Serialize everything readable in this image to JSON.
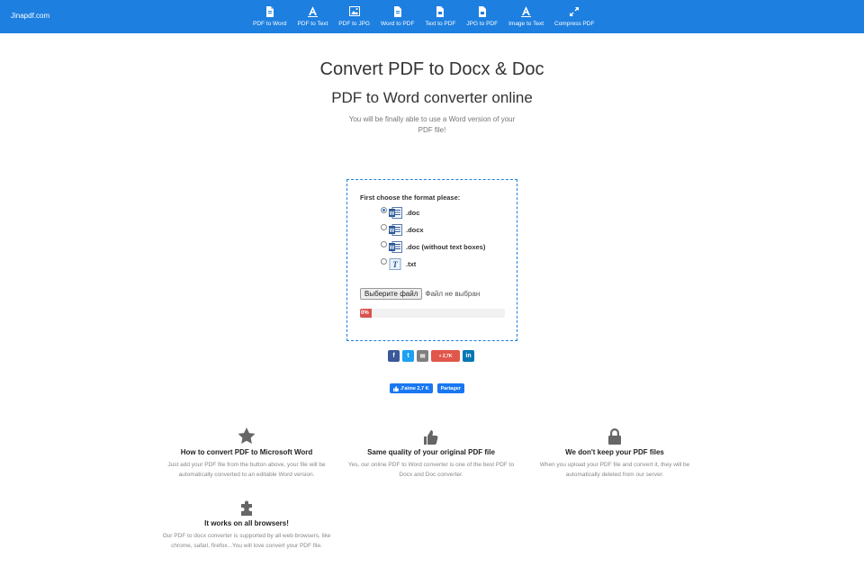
{
  "brand": "Jinapdf.com",
  "nav": [
    {
      "label": "PDF to Word",
      "icon": "file-word-icon"
    },
    {
      "label": "PDF to Text",
      "icon": "text-a-icon"
    },
    {
      "label": "PDF to JPG",
      "icon": "image-icon"
    },
    {
      "label": "Word to PDF",
      "icon": "file-word-icon"
    },
    {
      "label": "Text to PDF",
      "icon": "file-pdf-icon"
    },
    {
      "label": "JPG to PDF",
      "icon": "file-pdf-icon"
    },
    {
      "label": "Image to Text",
      "icon": "text-a-icon"
    },
    {
      "label": "Compress PDF",
      "icon": "compress-icon"
    }
  ],
  "hero": {
    "title": "Convert PDF to Docx & Doc",
    "subtitle": "PDF to Word converter online",
    "lead": "You will be finally able to use a Word version of your PDF file!"
  },
  "converter": {
    "format_label": "First choose the format please:",
    "options": [
      {
        "label": ".doc",
        "icon": "word-doc-icon",
        "checked": true
      },
      {
        "label": ".docx",
        "icon": "word-doc-icon",
        "checked": false
      },
      {
        "label": ".doc (without text boxes)",
        "icon": "word-doc-icon",
        "checked": false
      },
      {
        "label": ".txt",
        "icon": "text-file-icon",
        "checked": false
      }
    ],
    "file_button": "Выберите файл",
    "file_status": "Файл не выбран",
    "progress_label": "0%",
    "progress_value": 0,
    "progress_color": "#d9534f"
  },
  "share": {
    "buttons": [
      {
        "name": "facebook",
        "glyph": "f",
        "color": "#3b5998"
      },
      {
        "name": "twitter",
        "glyph": "t",
        "color": "#1da1f2"
      },
      {
        "name": "email",
        "glyph": "✉",
        "color": "#7f7f7f"
      },
      {
        "name": "google-plus",
        "glyph": "+ 2,7K",
        "color": "#e0564a"
      },
      {
        "name": "linkedin",
        "glyph": "in",
        "color": "#0077b5"
      }
    ],
    "fb_like": "J'aime 2,7 K",
    "fb_share": "Partager"
  },
  "features": [
    {
      "icon": "star-icon",
      "title": "How to convert PDF to Microsoft Word",
      "text": "Just add your PDF file from the button above, your file will be automatically converted to an editable Word version."
    },
    {
      "icon": "thumbs-up-icon",
      "title": "Same quality of your original PDF file",
      "text": "Yes, our online PDF to Word converter is one of the best PDF to Docx and Doc converter."
    },
    {
      "icon": "lock-icon",
      "title": "We don't keep your PDF files",
      "text": "When you upload your PDF file and convert it, they will be automatically deleted from our server."
    },
    {
      "icon": "puzzle-icon",
      "title": "It works on all browsers!",
      "text": "Our PDF to docx converter is supported by all web browsers, like chrome, safari, firefox...You will love convert your PDF file."
    }
  ],
  "colors": {
    "navbar": "#1d7fe0",
    "accent": "#1d7fe0"
  }
}
